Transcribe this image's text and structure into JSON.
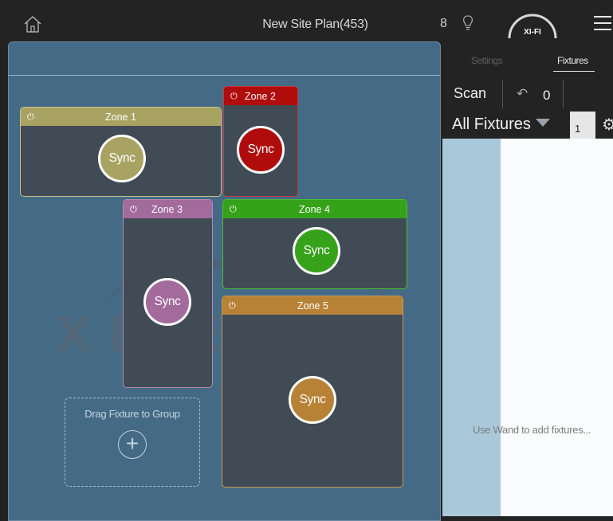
{
  "topbar": {
    "title": "New Site Plan(453)",
    "count": "8",
    "logo_text": "XI-FI",
    "icons": [
      "home-icon",
      "bulb-icon",
      "menu-icon"
    ]
  },
  "watermark": "XEIEUM",
  "zones": [
    {
      "name": "Zone 1",
      "sync_label": "Sync",
      "color": "#a8a362"
    },
    {
      "name": "Zone 2",
      "sync_label": "Sync",
      "color": "#b00c0c"
    },
    {
      "name": "Zone 3",
      "sync_label": "Sync",
      "color": "#a36a9c"
    },
    {
      "name": "Zone 4",
      "sync_label": "Sync",
      "color": "#36a21a"
    },
    {
      "name": "Zone 5",
      "sync_label": "Sync",
      "color": "#b88236"
    }
  ],
  "drop_target": {
    "label": "Drag Fixture to Group"
  },
  "panel": {
    "tabs": [
      "Settings",
      "Fixtures"
    ],
    "active_tab": "Fixtures",
    "scan_label": "Scan",
    "undo_count": "0",
    "filter_label": "All Fixtures",
    "page": "1",
    "empty_message": "Use Wand to add fixtures..."
  }
}
